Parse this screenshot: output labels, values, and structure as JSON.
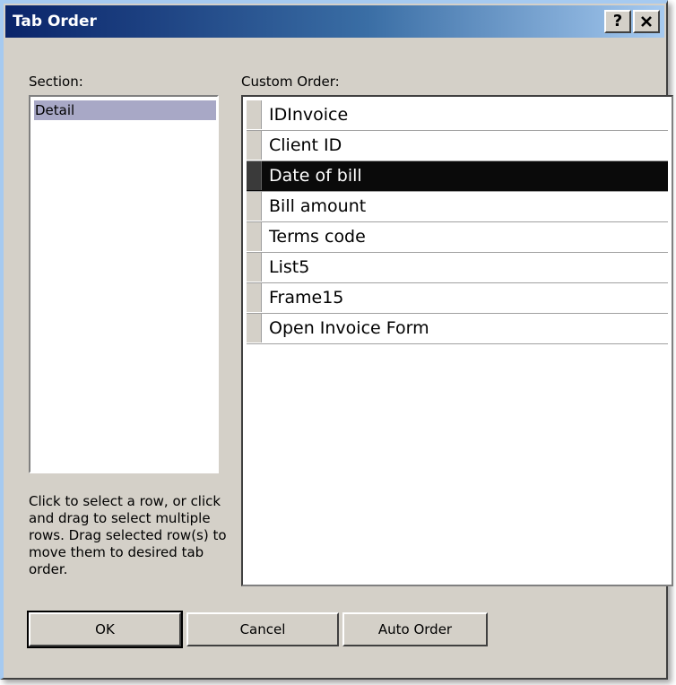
{
  "window": {
    "title": "Tab Order",
    "help_button": "?",
    "close_button": "✕"
  },
  "section": {
    "label": "Section:",
    "items": [
      "Detail"
    ],
    "selected": "Detail"
  },
  "custom_order": {
    "label": "Custom Order:",
    "rows": [
      "IDInvoice",
      "Client ID",
      "Date of bill",
      "Bill amount",
      "Terms code",
      "List5",
      "Frame15",
      "Open Invoice Form"
    ],
    "selected_row": "Date of bill"
  },
  "help_text": "Click to select a row, or click and drag to select multiple rows.  Drag selected row(s) to move them to desired tab order.",
  "buttons": {
    "ok": "OK",
    "cancel": "Cancel",
    "auto_order": "Auto Order"
  }
}
